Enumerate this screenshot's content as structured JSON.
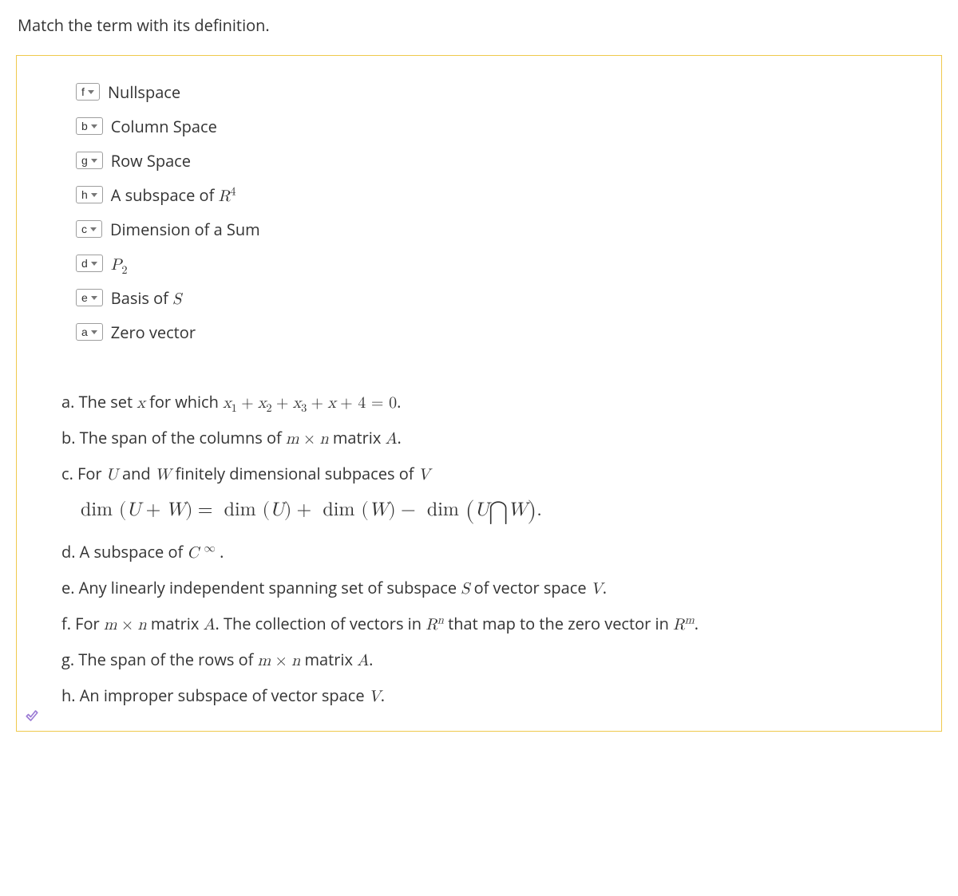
{
  "instruction": "Match the term with its definition.",
  "matches": [
    {
      "selected": "f",
      "term_html": "Nullspace"
    },
    {
      "selected": "b",
      "term_html": "Column Space"
    },
    {
      "selected": "g",
      "term_html": "Row Space"
    },
    {
      "selected": "h",
      "term_html": "A subspace of <span class='math-i'>R</span><span class='math-r sup'>4</span>"
    },
    {
      "selected": "c",
      "term_html": "Dimension of a Sum"
    },
    {
      "selected": "d",
      "term_html": "<span class='math-i'>P</span><span class='math-r sub'>2</span>"
    },
    {
      "selected": "e",
      "term_html": "Basis of <span class='math-i'>S</span>"
    },
    {
      "selected": "a",
      "term_html": "Zero vector"
    }
  ],
  "definitions": [
    "a. The set <span class='math-i'>x</span> for which <span class='math-i'>x</span><span class='math-r sub'>1</span> <span class='math-r'>+</span> <span class='math-i'>x</span><span class='math-r sub'>2</span> <span class='math-r'>+</span> <span class='math-i'>x</span><span class='math-r sub'>3</span> <span class='math-r'>+</span> <span class='math-i'>x</span> <span class='math-r'>+ 4 = 0</span>.",
    "b. The span of the columns of <span class='math-i'>m</span> <span class='math-r'>×</span> <span class='math-i'>n</span> matrix <span class='math-i'>A</span>.",
    "c. For <span class='math-i'>U</span> and <span class='math-i'>W</span> finitely dimensional subpaces of <span class='math-i'>V</span><br><span class='eq-line'><span class='math-r'>dim </span><span class='math-r'>(</span><span class='math-i'>U</span> <span class='math-r'>+</span> <span class='math-i'>W</span><span class='math-r'>)</span> <span class='math-r'>=&nbsp;</span> <span class='math-r'>dim </span><span class='math-r'>(</span><span class='math-i'>U</span><span class='math-r'>)</span> <span class='math-r'>+&nbsp;</span> <span class='math-r'>dim </span><span class='math-r'>(</span><span class='math-i'>W</span><span class='math-r'>)</span> <span class='math-r'>&minus;&nbsp;</span> <span class='math-r'>dim </span><span class='math-r bigparen'>(</span><span class='math-i'>U</span><span class='math-r bigop'>&#8898;</span><span class='math-i'>W</span><span class='math-r bigparen'>)</span><span class='math-r'>.</span></span>",
    "d. A subspace of <span class='math-i'>C</span><span class='math-r'>&nbsp;</span><span class='math-r sup'>&infin;</span> .",
    "e. Any linearly independent spanning set of subspace <span class='math-i'>S</span> of vector space <span class='math-i'>V</span>.",
    "f. For <span class='math-i'>m</span> <span class='math-r'>×</span> <span class='math-i'>n</span> matrix <span class='math-i'>A</span>. The collection of vectors in <span class='math-i'>R</span><span class='math-i sup'>n</span> that map to the zero vector in <span class='math-i'>R</span><span class='math-i sup'>m</span>.",
    "g. The span of the rows of <span class='math-i'>m</span> <span class='math-r'>×</span> <span class='math-i'>n</span> matrix <span class='math-i'>A</span>.",
    "h. An improper subspace of vector space <span class='math-i'>V</span>."
  ],
  "icons": {
    "correct": "check-icon"
  },
  "colors": {
    "box_border": "#efc94c",
    "check": "#9b7bd4"
  }
}
